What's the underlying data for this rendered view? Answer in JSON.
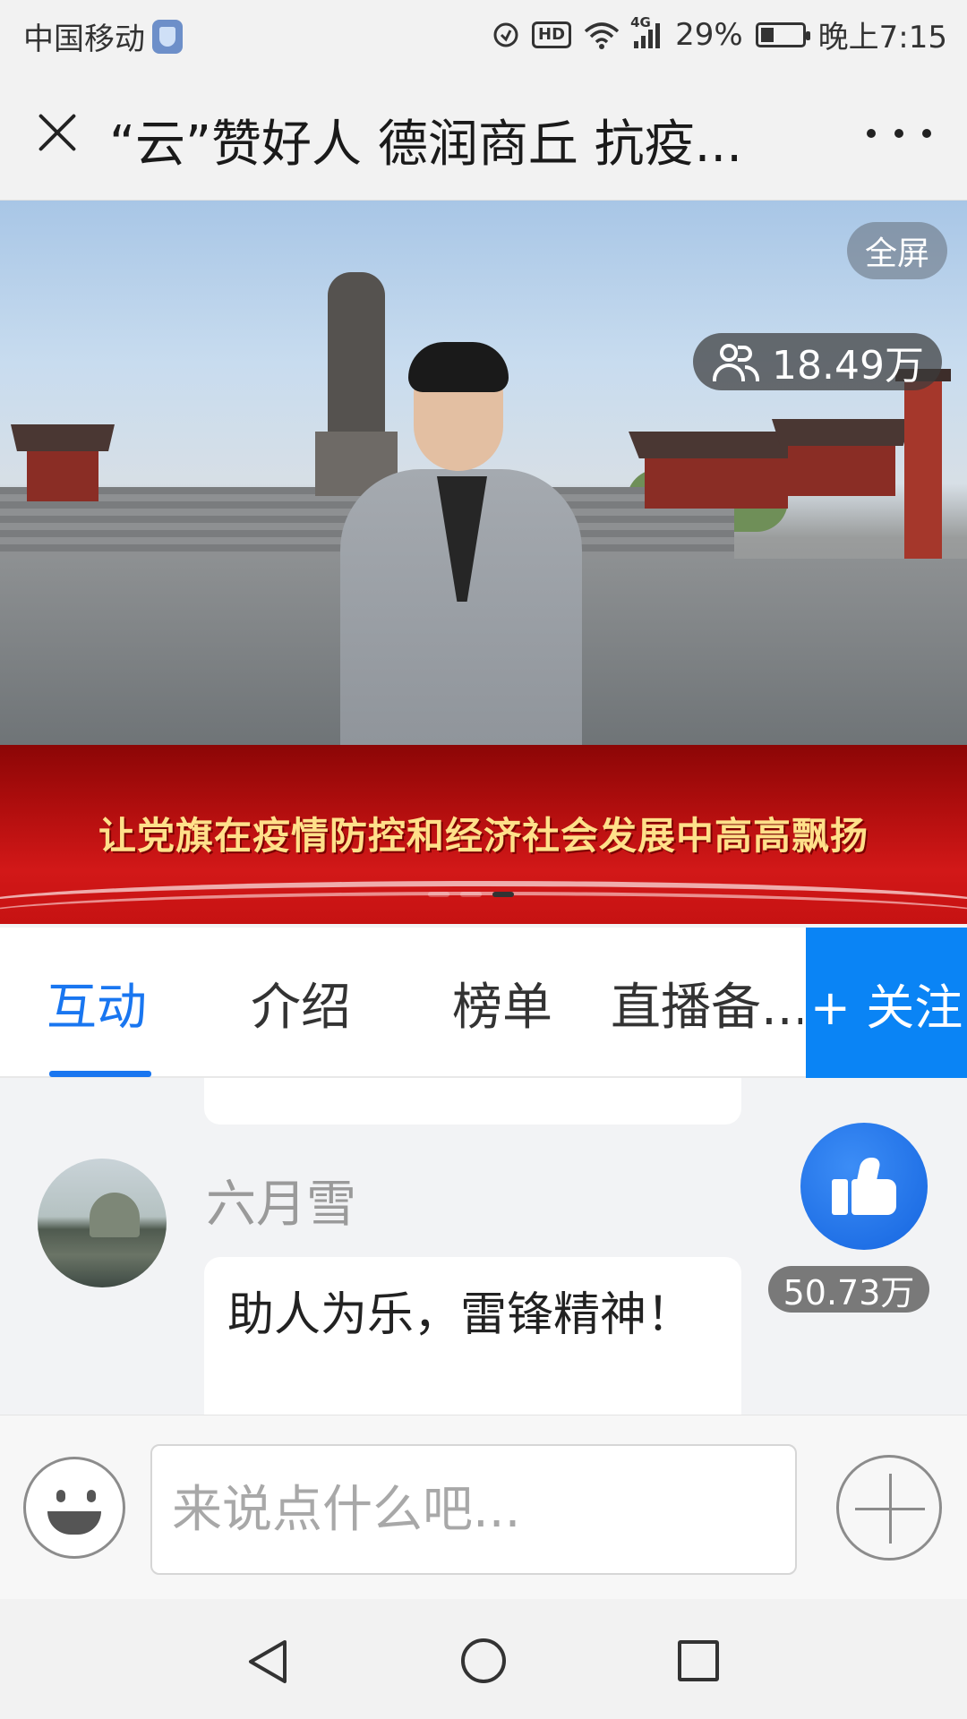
{
  "status_bar": {
    "carrier": "中国移动",
    "network": "4G",
    "hd": "HD",
    "battery_percent": "29%",
    "battery_level": 0.29,
    "time": "晚上7:15"
  },
  "title_bar": {
    "title": "“云”赞好人 德润商丘 抗疫..."
  },
  "video": {
    "fullscreen_label": "全屏",
    "viewer_count": "18.49万"
  },
  "banner": {
    "text": "让党旗在疫情防控和经济社会发展中高高飘扬"
  },
  "tabs": {
    "items": [
      {
        "label": "互动"
      },
      {
        "label": "介绍"
      },
      {
        "label": "榜单"
      },
      {
        "label": "直播备..."
      }
    ],
    "active_index": 0,
    "follow_label": "+ 关注"
  },
  "comments": {
    "items": [
      {
        "name": "六月雪",
        "text": "助人为乐，雷锋精神！"
      }
    ]
  },
  "like": {
    "count": "50.73万"
  },
  "input": {
    "placeholder": "来说点什么吧..."
  },
  "colors": {
    "accent": "#1976f0",
    "follow_bg": "#0a84f5",
    "banner_red": "#c61212",
    "banner_text": "#ffe08a"
  }
}
